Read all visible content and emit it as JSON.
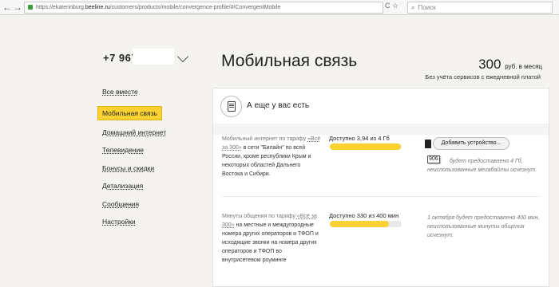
{
  "browser": {
    "url_prefix": "https://ekaterinburg.",
    "url_domain": "beeline.ru",
    "url_path": "/customers/products/mobile/convergence-profile/#/ConvergentMobile",
    "reload_icon": "C",
    "bookmark_icon": "☆",
    "search_placeholder": "Поиск",
    "back_icon": "←",
    "forward_icon": "→"
  },
  "account": {
    "phone_prefix": "+7 967"
  },
  "sidebar": {
    "items": [
      {
        "label": "Все вместе"
      },
      {
        "label": "Мобильная связь",
        "active": true
      },
      {
        "label": "Домашний интернет"
      },
      {
        "label": "Телевидение"
      },
      {
        "label": "Бонусы и скидки"
      },
      {
        "label": "Детализация"
      },
      {
        "label": "Сообщения"
      },
      {
        "label": "Настройки"
      }
    ]
  },
  "header": {
    "title": "Мобильная связь",
    "price": "300",
    "price_unit": "руб. в месяц",
    "price_note": "Без учёта сервисов с ежедневной платой"
  },
  "card": {
    "title": "А еще у вас есть",
    "internet": {
      "desc_prefix": "Мобильный интернет по тарифу ",
      "tariff": "«Всё за 300»",
      "desc_rest": "в сети \"Билайн\" по всей России, кроме республики Крым и некоторых областей Дальнего Востока и Сибири.",
      "available": "Доступно 3,94 из 4 Гб",
      "fraction": 0.985,
      "add_button": "Добавить устройство...",
      "note": "будет предоставлено 4 Гб, неиспользованные мегабайты исчезнут.",
      "tooltip": "906"
    },
    "minutes": {
      "desc_prefix": "Минуты общения по тарифу ",
      "tariff": "«Всё за 300»",
      "desc_rest": "на местные и междугородные номера других операторов и ТФОП и исходящие звонки на номера других операторов и ТФОП во внутрисетевом роуминге",
      "available": "Доступно 330 из 400 мин",
      "fraction": 0.825,
      "note": "1 октября будет предоставлено 400 мин, неиспользованные минуты общения исчезнут."
    }
  },
  "colors": {
    "accent": "#fbd232",
    "accent_border": "#e2b319"
  }
}
